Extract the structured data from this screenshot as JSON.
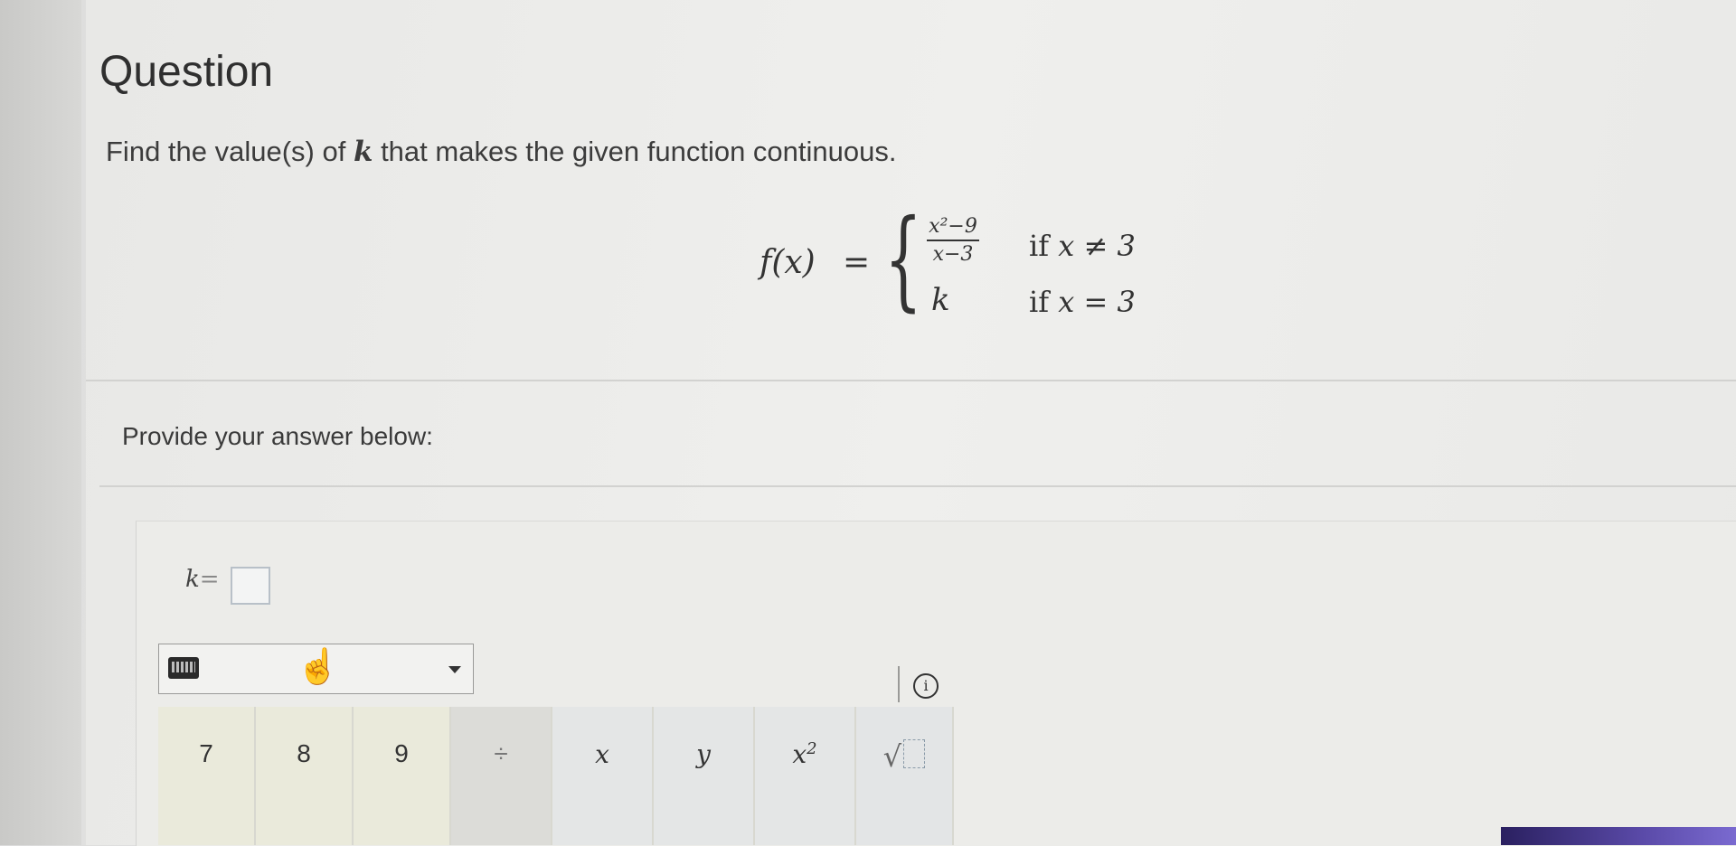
{
  "question": {
    "title": "Question",
    "prompt_before": "Find the value(s) of ",
    "prompt_var": "k",
    "prompt_after": " that makes the given function continuous."
  },
  "function": {
    "lhs": "f(x)",
    "equals": "=",
    "numerator": "x²−9",
    "denominator": "x−3",
    "case1_condition_if": "if ",
    "case1_condition_expr": "x ≠ 3",
    "case2_value": "k",
    "case2_condition_if": "if ",
    "case2_condition_expr": "x = 3"
  },
  "answer": {
    "label": "Provide your answer below:",
    "var": "k",
    "equals": "=",
    "input_value": ""
  },
  "keypad": {
    "keys": [
      "7",
      "8",
      "9",
      "÷",
      "x",
      "y",
      "x",
      "√"
    ],
    "x_squared_exp": "2",
    "info": "i"
  },
  "icons": [
    "keyboard-icon",
    "chevron-down-icon",
    "hand-pointer-icon",
    "info-icon"
  ]
}
